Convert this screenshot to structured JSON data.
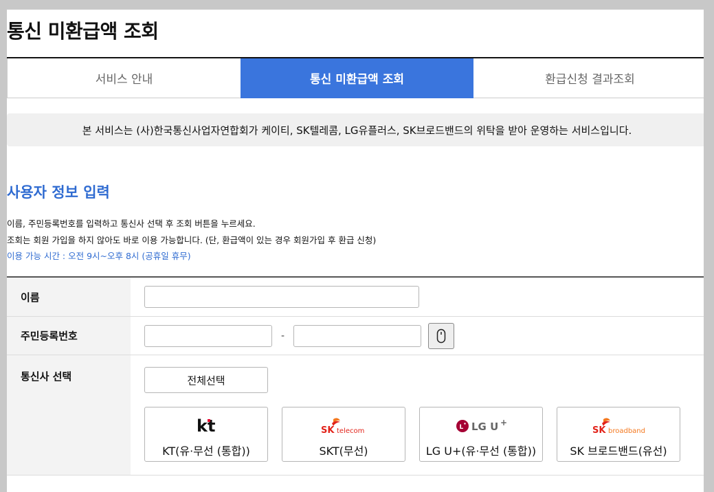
{
  "page": {
    "title": "통신 미환급액 조회"
  },
  "tabs": [
    {
      "label": "서비스 안내",
      "active": false
    },
    {
      "label": "통신 미환급액 조회",
      "active": true
    },
    {
      "label": "환급신청 결과조회",
      "active": false
    }
  ],
  "notice": "본 서비스는 (사)한국통신사업자연합회가 케이티, SK텔레콤, LG유플러스, SK브로드밴드의 위탁을 받아 운영하는 서비스입니다.",
  "section": {
    "title": "사용자 정보 입력",
    "desc_line1": "이름, 주민등록번호를 입력하고 통신사 선택 후 조회 버튼을 누르세요.",
    "desc_line2": "조회는 회원 가입을 하지 않아도 바로 이용 가능합니다. (단, 환급액이 있는 경우 회원가입 후 환급 신청)",
    "hours": "이용 가능 시간 : 오전 9시~오후 8시 (공휴일 휴무)"
  },
  "form": {
    "name_label": "이름",
    "name_value": "",
    "ssn_label": "주민등록번호",
    "ssn_front_value": "",
    "ssn_back_value": "",
    "ssn_dash": "-",
    "carrier_label": "통신사 선택",
    "select_all_label": "전체선택"
  },
  "carriers": [
    {
      "logo_text": "kt",
      "label": "KT(유·무선 (통합))"
    },
    {
      "logo_text": "SK telecom",
      "label": "SKT(무선)"
    },
    {
      "logo_text": "LG U+",
      "label": "LG U+(유·무선 (통합))"
    },
    {
      "logo_text": "SK broadband",
      "label": "SK 브로드밴드(유선)"
    }
  ],
  "colors": {
    "accent": "#3a75dd",
    "sk_red": "#e2231a",
    "sk_orange": "#f47920",
    "lg_magenta": "#a50034",
    "kt_red": "#e4002b"
  }
}
